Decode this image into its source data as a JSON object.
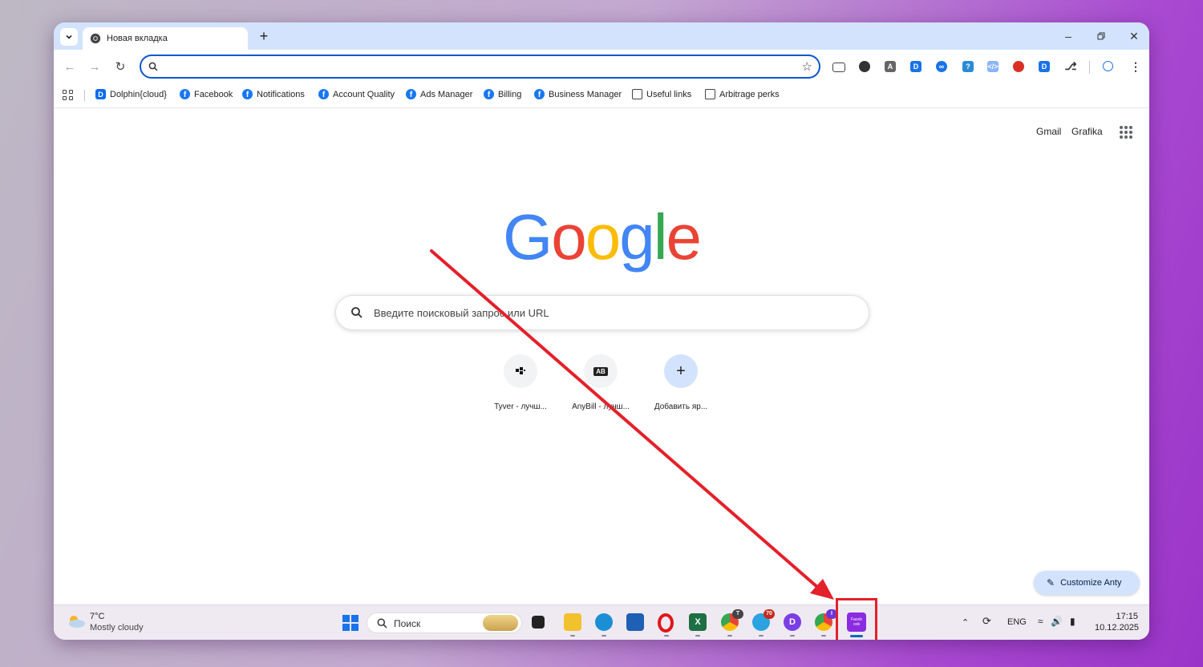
{
  "tab": {
    "title": "Новая вкладка"
  },
  "omnibox": {
    "value": ""
  },
  "bookmarks": [
    {
      "label": "Dolphin{cloud}",
      "icon": "dolphin-icon"
    },
    {
      "label": "Facebook",
      "icon": "facebook-icon"
    },
    {
      "label": "Notifications",
      "icon": "facebook-icon"
    },
    {
      "label": "Account Quality",
      "icon": "facebook-icon"
    },
    {
      "label": "Ads Manager",
      "icon": "facebook-icon"
    },
    {
      "label": "Billing",
      "icon": "facebook-icon"
    },
    {
      "label": "Business Manager",
      "icon": "facebook-icon"
    },
    {
      "label": "Useful links",
      "icon": "folder-icon"
    },
    {
      "label": "Arbitrage perks",
      "icon": "folder-icon"
    }
  ],
  "header_links": {
    "gmail": "Gmail",
    "images": "Grafika"
  },
  "logo": {
    "letters": [
      "G",
      "o",
      "o",
      "g",
      "l",
      "e"
    ],
    "colors": [
      "#4285f4",
      "#ea4335",
      "#fbbc05",
      "#4285f4",
      "#34a853",
      "#ea4335"
    ]
  },
  "search": {
    "placeholder": "Введите поисковый запрос или URL"
  },
  "shortcuts": [
    {
      "label": "Tyver - лучш...",
      "icon_text": "▪▫"
    },
    {
      "label": "AnyBill - лучш...",
      "icon_text": "AB"
    },
    {
      "label": "Добавить яр...",
      "icon_text": "+"
    }
  ],
  "customize": {
    "label": "Customize Anty"
  },
  "taskbar": {
    "weather_temp": "7°C",
    "weather_desc": "Mostly cloudy",
    "search_label": "Поиск",
    "telegram_badge": "70",
    "chrome_badge_1": "T",
    "chrome_badge_2": "I",
    "fb_app_text": "Faceb ook",
    "language": "ENG",
    "time": "17:15",
    "date": "10.12.2025"
  },
  "colors": {
    "accent": "#0b57d0",
    "annotation": "#e4202a",
    "tab_strip": "#d3e3fd"
  }
}
